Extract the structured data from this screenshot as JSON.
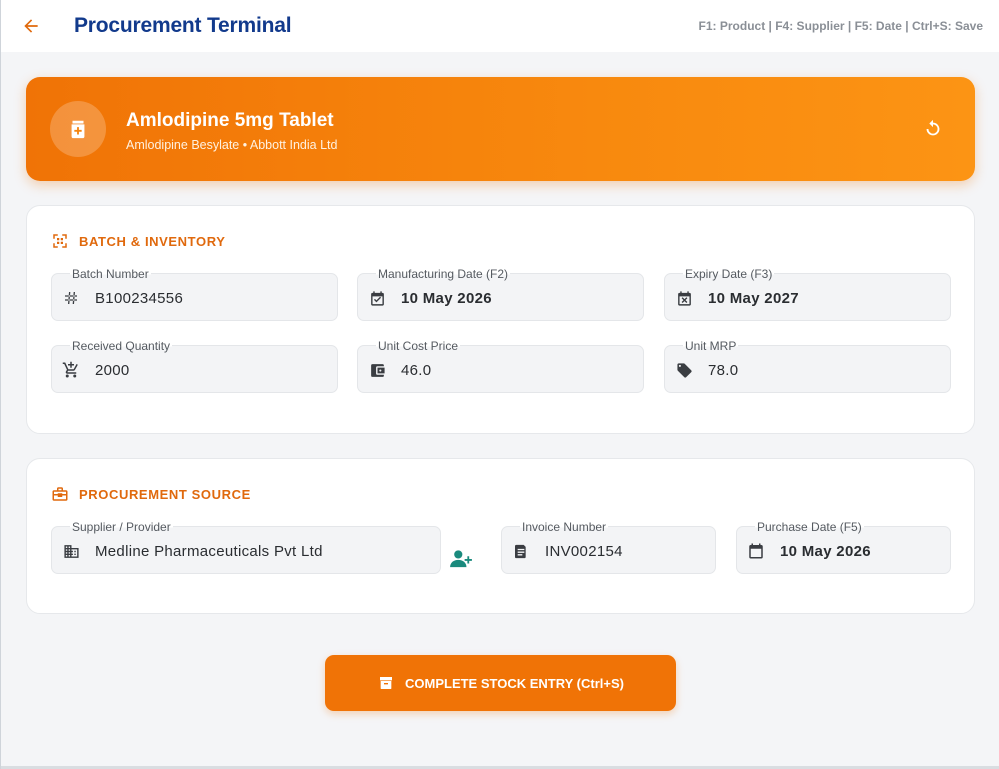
{
  "header": {
    "title": "Procurement Terminal",
    "shortcuts": "F1: Product | F4: Supplier | F5: Date | Ctrl+S: Save",
    "back_icon": "arrow-left-icon"
  },
  "product": {
    "name": "Amlodipine 5mg Tablet",
    "subtitle": "Amlodipine Besylate • Abbott India Ltd",
    "icon": "medicine-bottle-icon",
    "refresh_icon": "refresh-icon"
  },
  "batch": {
    "section_title": "BATCH & INVENTORY",
    "batch_number": {
      "label": "Batch Number",
      "value": "B100234556",
      "icon": "hash-icon"
    },
    "mfg_date": {
      "label": "Manufacturing Date (F2)",
      "value": "10 May 2026",
      "icon": "calendar-check-icon"
    },
    "expiry_date": {
      "label": "Expiry Date (F3)",
      "value": "10 May 2027",
      "icon": "calendar-x-icon"
    },
    "quantity": {
      "label": "Received Quantity",
      "value": "2000",
      "icon": "cart-add-icon"
    },
    "unit_cost": {
      "label": "Unit Cost Price",
      "value": "46.0",
      "icon": "wallet-icon"
    },
    "unit_mrp": {
      "label": "Unit MRP",
      "value": "78.0",
      "icon": "tag-icon"
    }
  },
  "source": {
    "section_title": "PROCUREMENT SOURCE",
    "supplier": {
      "label": "Supplier / Provider",
      "value": "Medline Pharmaceuticals Pvt Ltd",
      "icon": "building-icon"
    },
    "invoice": {
      "label": "Invoice Number",
      "value": "INV002154",
      "icon": "receipt-icon"
    },
    "purchase_date": {
      "label": "Purchase Date (F5)",
      "value": "10 May 2026",
      "icon": "calendar-icon"
    },
    "add_supplier_icon": "add-person-icon"
  },
  "actions": {
    "submit_label": "COMPLETE STOCK ENTRY (Ctrl+S)",
    "submit_icon": "archive-icon"
  },
  "colors": {
    "accent": "#f07306",
    "title": "#123a8c",
    "teal": "#1a8a7d"
  }
}
